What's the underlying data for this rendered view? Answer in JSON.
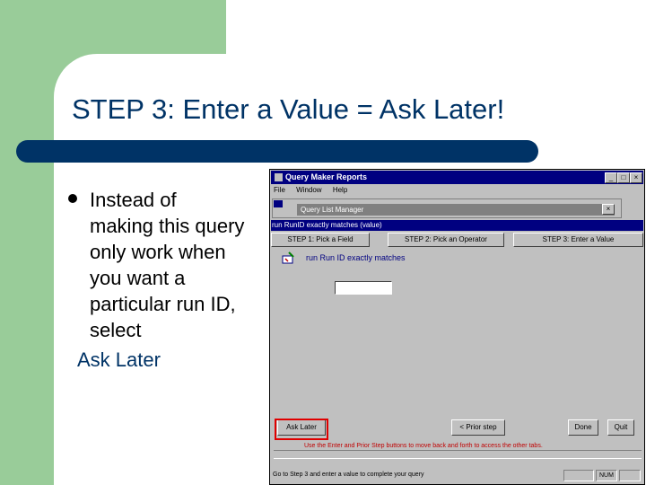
{
  "slide": {
    "title": "STEP 3: Enter a Value = Ask Later!",
    "bullet": "Instead of\nmaking this query\nonly work when\nyou want a\nparticular run ID,\nselect",
    "ask_later": "Ask Later"
  },
  "app": {
    "title": "Query Maker Reports",
    "menu": [
      "File",
      "Window",
      "Help"
    ],
    "subwindow_title": "Query List Manager",
    "query_text": "run RunID exactly matches (value)",
    "steps": [
      "STEP 1: Pick a Field",
      "STEP 2: Pick an Operator",
      "STEP 3: Enter a Value"
    ],
    "field_label": "run Run ID exactly matches",
    "value": "",
    "buttons": {
      "ask_later": "Ask Later",
      "prior_step": "< Prior step",
      "done": "Done",
      "quit": "Quit"
    },
    "hint": "Use the Enter and Prior Step buttons to move back and forth to access the other tabs.",
    "status": {
      "message": "Go to Step 3 and enter a value to complete your query",
      "indicator": "NUM"
    }
  },
  "colors": {
    "slide_green": "#99cc99",
    "title_navy": "#003366",
    "window_gray": "#c0c0c0",
    "titlebar_blue": "#000080",
    "highlight_red": "#e00000"
  }
}
